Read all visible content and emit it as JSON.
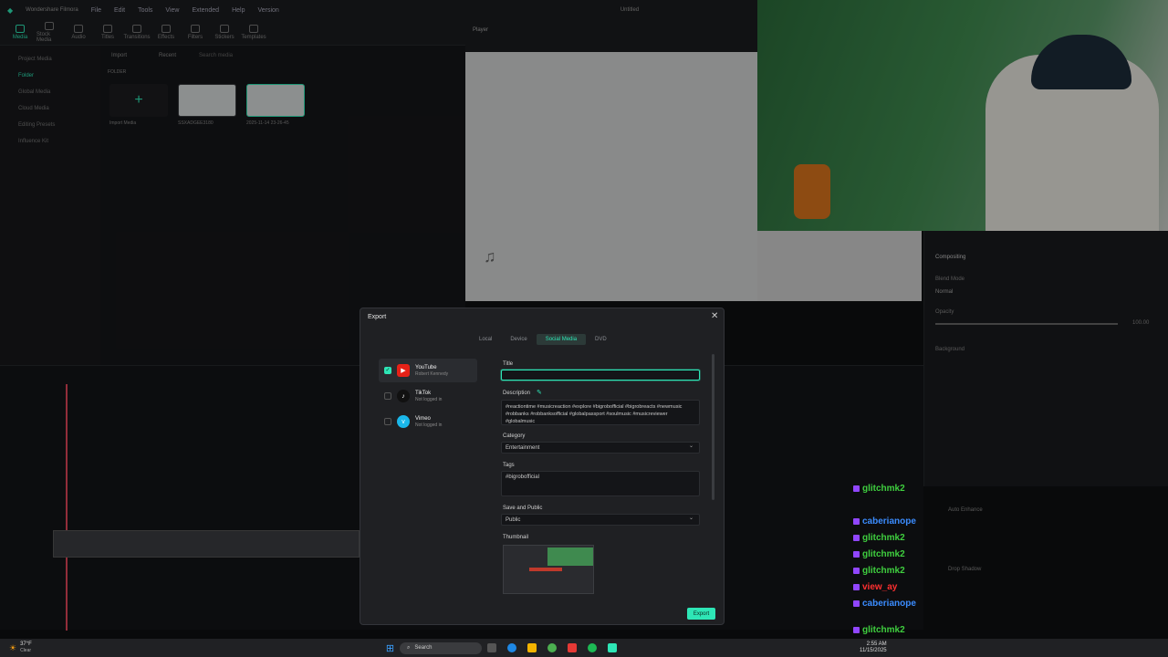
{
  "app": {
    "name": "Wondershare Filmora",
    "menu": [
      "File",
      "Edit",
      "Tools",
      "View",
      "Extended",
      "Help",
      "Version"
    ],
    "project": "Untitled"
  },
  "toolbar": [
    "Media",
    "Stock Media",
    "Audio",
    "Titles",
    "Transitions",
    "Effects",
    "Filters",
    "Stickers",
    "Templates"
  ],
  "sidebar": [
    "Project Media",
    "Folder",
    "Global Media",
    "Cloud Media",
    "Editing Presets",
    "Influence Kit"
  ],
  "media": {
    "import": "Import",
    "recent": "Recent",
    "search_placeholder": "Search media",
    "folder_label": "FOLDER",
    "import_media": "Import Media",
    "clips": [
      {
        "name": "SSXADGEE3180",
        "duration": "00:00:05"
      },
      {
        "name": "2025-11-14 23-26-45",
        "duration": "00:04:33"
      }
    ]
  },
  "player": {
    "label": "Player"
  },
  "right_panel": {
    "compositing": "Compositing",
    "blend_mode": "Blend Mode",
    "blend_value": "Normal",
    "opacity": "Opacity",
    "opacity_value": "100.00",
    "background": "Background",
    "auto_enhance": "Auto Enhance",
    "drop_shadow": "Drop Shadow",
    "reset": "Reset"
  },
  "export": {
    "title": "Export",
    "tabs": [
      "Local",
      "Device",
      "Social Media",
      "DVD"
    ],
    "platforms": [
      {
        "name": "YouTube",
        "sub": "Robert Kennedy",
        "checked": true,
        "icon": "youtube-icon",
        "color": "#e62117"
      },
      {
        "name": "TikTok",
        "sub": "Not logged in",
        "checked": false,
        "icon": "tiktok-icon",
        "color": "#111111"
      },
      {
        "name": "Vimeo",
        "sub": "Not logged in",
        "checked": false,
        "icon": "vimeo-icon",
        "color": "#1ab7ea"
      }
    ],
    "title_label": "Title",
    "title_value": "",
    "description_label": "Description",
    "description_value": "#reactiontime #musicreaction #explore #bigrobofficial #bigrobreacts #newmusic #robbanks #robbanksofficial #globalpassport #soulmusic #musicreviewer #globalmusic",
    "category_label": "Category",
    "category_value": "Entertainment",
    "tags_label": "Tags",
    "tags_value": "#bigrobofficial",
    "privacy_label": "Save and Public",
    "privacy_value": "Public",
    "thumbnail_label": "Thumbnail",
    "export_button": "Export"
  },
  "chat": [
    {
      "user": "glitchmk2",
      "color": "#3fcf3f"
    },
    {
      "user": "caberianope",
      "color": "#3b8cff"
    },
    {
      "user": "glitchmk2",
      "color": "#3fcf3f"
    },
    {
      "user": "glitchmk2",
      "color": "#3fcf3f"
    },
    {
      "user": "glitchmk2",
      "color": "#3fcf3f"
    },
    {
      "user": "view_ay",
      "color": "#ff3030"
    },
    {
      "user": "caberianope",
      "color": "#3b8cff"
    },
    {
      "user": "glitchmk2",
      "color": "#3fcf3f"
    },
    {
      "user": "glitchmk2",
      "color": "#3fcf3f"
    }
  ],
  "taskbar": {
    "weather_temp": "37°F",
    "weather_desc": "Clear",
    "search": "Search",
    "time": "2:55 AM",
    "date": "11/15/2025"
  }
}
